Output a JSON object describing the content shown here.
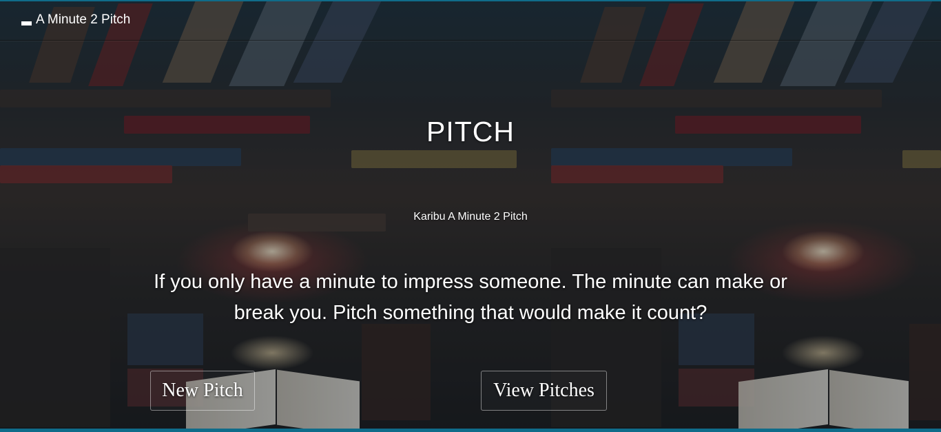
{
  "navbar": {
    "brand_icon": "minus-icon",
    "brand_label": "A Minute 2 Pitch"
  },
  "hero": {
    "title": "PITCH",
    "subtitle": "Karibu A Minute 2 Pitch",
    "text": "If you only have a minute to impress someone. The minute can make or break you. Pitch something that would make it count?"
  },
  "actions": {
    "new_pitch_label": "New Pitch",
    "view_pitches_label": "View Pitches"
  },
  "colors": {
    "accent": "#0f6c8a",
    "text": "#ffffff"
  }
}
